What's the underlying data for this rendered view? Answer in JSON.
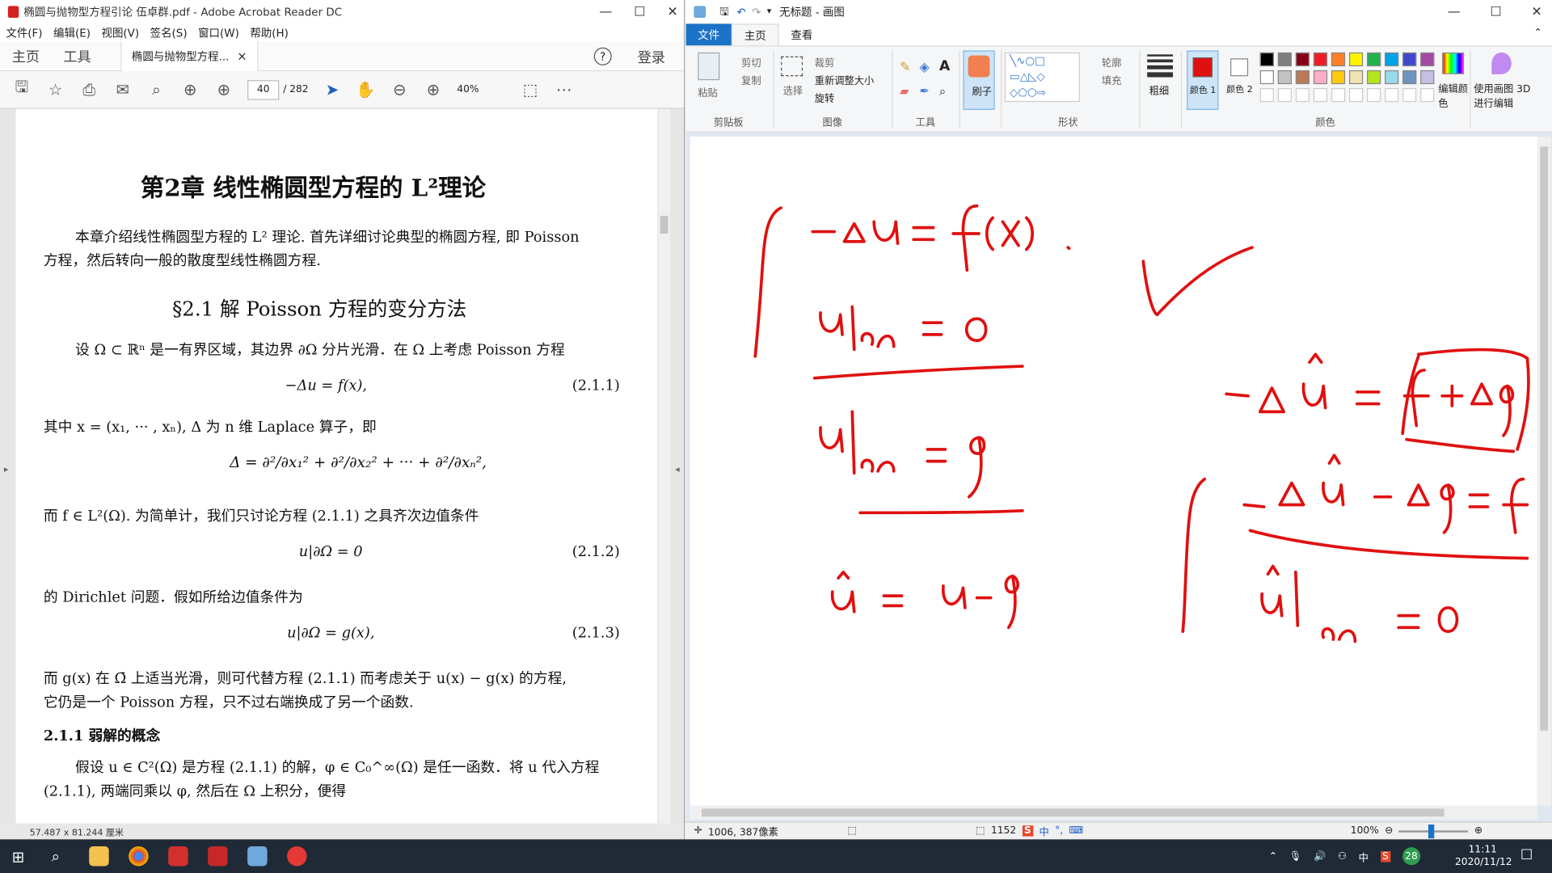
{
  "acrobat": {
    "title": "椭圆与抛物型方程引论 伍卓群.pdf - Adobe Acrobat Reader DC",
    "menu": [
      "文件(F)",
      "编辑(E)",
      "视图(V)",
      "签名(S)",
      "窗口(W)",
      "帮助(H)"
    ],
    "tabs": {
      "home": "主页",
      "tools": "工具",
      "doc": "椭圆与抛物型方程...",
      "close": "×",
      "help": "?",
      "login": "登录"
    },
    "toolbar": {
      "page_current": "40",
      "page_total": "/ 282",
      "zoom": "40%"
    },
    "status": "57.487 x 81.244 厘米",
    "doc": {
      "chapter_title": "第2章  线性椭圆型方程的 L²理论",
      "intro1": "本章介绍线性椭圆型方程的 L² 理论. 首先详细讨论典型的椭圆方程, 即 Poisson",
      "intro2": "方程，然后转向一般的散度型线性椭圆方程.",
      "section_title": "§2.1  解 Poisson 方程的变分方法",
      "p1": "设 Ω ⊂ ℝⁿ 是一有界区域，其边界 ∂Ω 分片光滑．在 Ω 上考虑 Poisson 方程",
      "eq1": "−Δu = f(x),",
      "eq1_no": "(2.1.1)",
      "p2": "其中 x = (x₁, ··· , xₙ), Δ 为 n 维 Laplace 算子，即",
      "eq_laplace": "Δ = ∂²/∂x₁² + ∂²/∂x₂² + ··· + ∂²/∂xₙ²,",
      "p3": "而 f ∈ L²(Ω). 为简单计，我们只讨论方程 (2.1.1) 之具齐次边值条件",
      "eq2": "u|∂Ω = 0",
      "eq2_no": "(2.1.2)",
      "p4": "的 Dirichlet 问题．假如所给边值条件为",
      "eq3": "u|∂Ω = g(x),",
      "eq3_no": "(2.1.3)",
      "p5": "而 g(x) 在 Ω̄ 上适当光滑，则可代替方程 (2.1.1) 而考虑关于 u(x) − g(x) 的方程,",
      "p6": "它仍是一个 Poisson 方程，只不过右端换成了另一个函数.",
      "subsection": "2.1.1   弱解的概念",
      "p7": "假设 u ∈ C²(Ω) 是方程 (2.1.1) 的解，φ ∈ C₀^∞(Ω) 是任一函数．将 u 代入方程",
      "p8": "(2.1.1), 两端同乘以 φ, 然后在 Ω 上积分，便得"
    }
  },
  "paint": {
    "title": "无标题 - 画图",
    "tabs": {
      "file": "文件",
      "home": "主页",
      "view": "查看"
    },
    "clipboard": {
      "paste": "粘贴",
      "cut": "剪切",
      "copy": "复制",
      "label": "剪贴板"
    },
    "image": {
      "select": "选择",
      "crop": "裁剪",
      "resize": "重新调整大小",
      "rotate": "旋转",
      "label": "图像"
    },
    "tools": {
      "label": "工具"
    },
    "brush": {
      "label": "刷子"
    },
    "shapes": {
      "outline": "轮廓",
      "fill": "填充",
      "label": "形状"
    },
    "size": {
      "label": "粗细"
    },
    "colors": {
      "color1": "颜色 1",
      "color2": "颜色 2",
      "edit": "编辑颜色",
      "paint3d": "使用画图 3D 进行编辑",
      "label": "颜色"
    },
    "status": {
      "coords": "1006, 387像素",
      "selection": "1152",
      "zoom": "100%"
    },
    "palette_row1": [
      "#000000",
      "#7f7f7f",
      "#880015",
      "#ed1c24",
      "#ff7f27",
      "#fff200",
      "#22b14c",
      "#00a2e8",
      "#3f48cc",
      "#a349a4"
    ],
    "palette_row2": [
      "#ffffff",
      "#c3c3c3",
      "#b97a57",
      "#ffaec9",
      "#ffc90e",
      "#efe4b0",
      "#b5e61d",
      "#99d9ea",
      "#7092be",
      "#c8bfe7"
    ],
    "ink_color": "#e01010"
  },
  "taskbar": {
    "time": "11:11",
    "date": "2020/11/12",
    "ime": "中",
    "badge": "28"
  }
}
